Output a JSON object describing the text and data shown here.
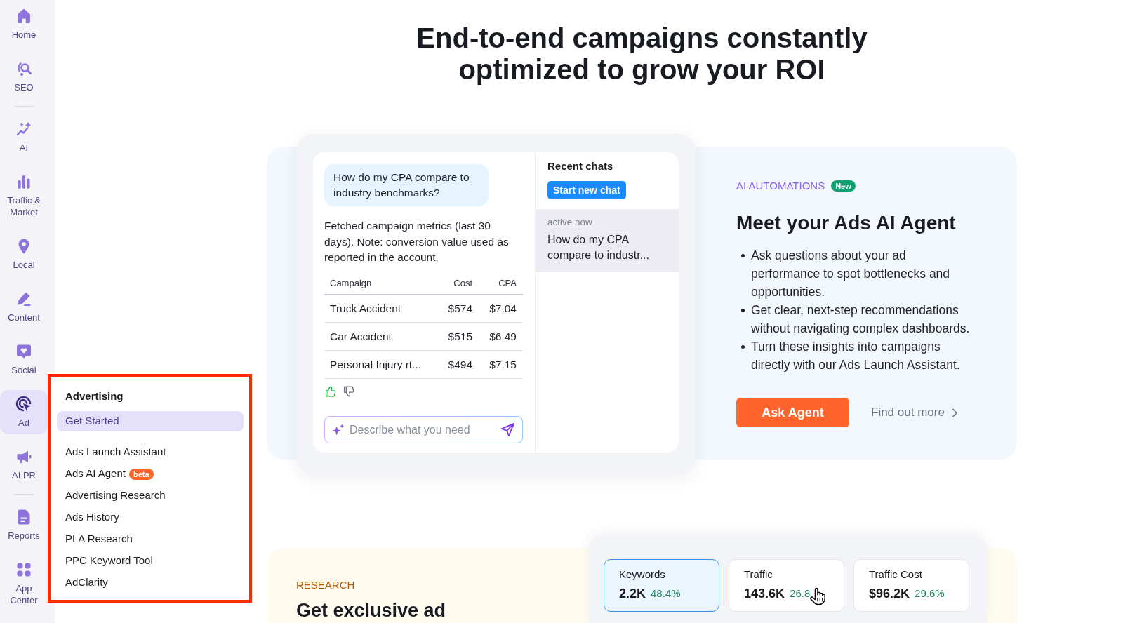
{
  "sidebar": {
    "groups": [
      {
        "items": [
          {
            "label": "Home",
            "selected": false
          },
          {
            "label": "SEO",
            "selected": false
          }
        ]
      },
      {
        "items": [
          {
            "label": "AI",
            "selected": false
          },
          {
            "label": "Traffic & Market",
            "selected": false
          },
          {
            "label": "Local",
            "selected": false
          },
          {
            "label": "Content",
            "selected": false
          },
          {
            "label": "Social",
            "selected": false
          },
          {
            "label": "Ad",
            "selected": true
          },
          {
            "label": "AI PR",
            "selected": false
          }
        ]
      },
      {
        "items": [
          {
            "label": "Reports",
            "selected": false
          },
          {
            "label": "App Center",
            "selected": false
          }
        ]
      }
    ]
  },
  "flyout": {
    "title": "Advertising",
    "groups": [
      {
        "items": [
          {
            "label": "Get Started",
            "selected": true
          }
        ]
      },
      {
        "items": [
          {
            "label": "Ads Launch Assistant",
            "selected": false
          },
          {
            "label": "Ads AI Agent",
            "selected": false,
            "badge": "beta"
          },
          {
            "label": "Advertising Research",
            "selected": false
          },
          {
            "label": "Ads History",
            "selected": false
          },
          {
            "label": "PLA Research",
            "selected": false
          },
          {
            "label": "PPC Keyword Tool",
            "selected": false
          },
          {
            "label": "AdClarity",
            "selected": false
          }
        ]
      }
    ]
  },
  "headline": "End-to-end campaigns constantly optimized to grow your ROI",
  "chat": {
    "question": "How do my CPA compare to industry benchmarks?",
    "answer": "Fetched campaign metrics (last 30 days). Note: conversion value used as reported in the account.",
    "table": {
      "columns": [
        "Campaign",
        "Cost",
        "CPA"
      ],
      "rows": [
        [
          "Truck Accident",
          "$574",
          "$7.04"
        ],
        [
          "Car Accident",
          "$515",
          "$6.49"
        ],
        [
          "Personal Injury rt...",
          "$494",
          "$7.15"
        ]
      ]
    },
    "input": {
      "placeholder": "Describe what you need"
    },
    "recent": {
      "title": "Recent chats",
      "new_chat_button": "Start new chat",
      "items": [
        {
          "time": "active now",
          "title": "How do my CPA compare to industr...",
          "selected": true
        }
      ]
    }
  },
  "feature": {
    "eyebrow": "AI AUTOMATIONS",
    "badge": "New",
    "title": "Meet your Ads AI Agent",
    "bullets": [
      "Ask questions about your ad performance to spot bottlenecks and opportunities.",
      "Get clear, next-step recommendations without navigating complex dashboards.",
      "Turn these insights into campaigns directly with our Ads Launch Assistant."
    ],
    "primary_button": "Ask Agent",
    "link": "Find out more"
  },
  "research": {
    "eyebrow": "RESEARCH",
    "title": "Get exclusive ad",
    "metrics": [
      {
        "label": "Keywords",
        "value": "2.2K",
        "change": "48.4%",
        "selected": true
      },
      {
        "label": "Traffic",
        "value": "143.6K",
        "change": "26.8",
        "selected": false
      },
      {
        "label": "Traffic Cost",
        "value": "$96.2K",
        "change": "29.6%",
        "selected": false
      }
    ]
  }
}
